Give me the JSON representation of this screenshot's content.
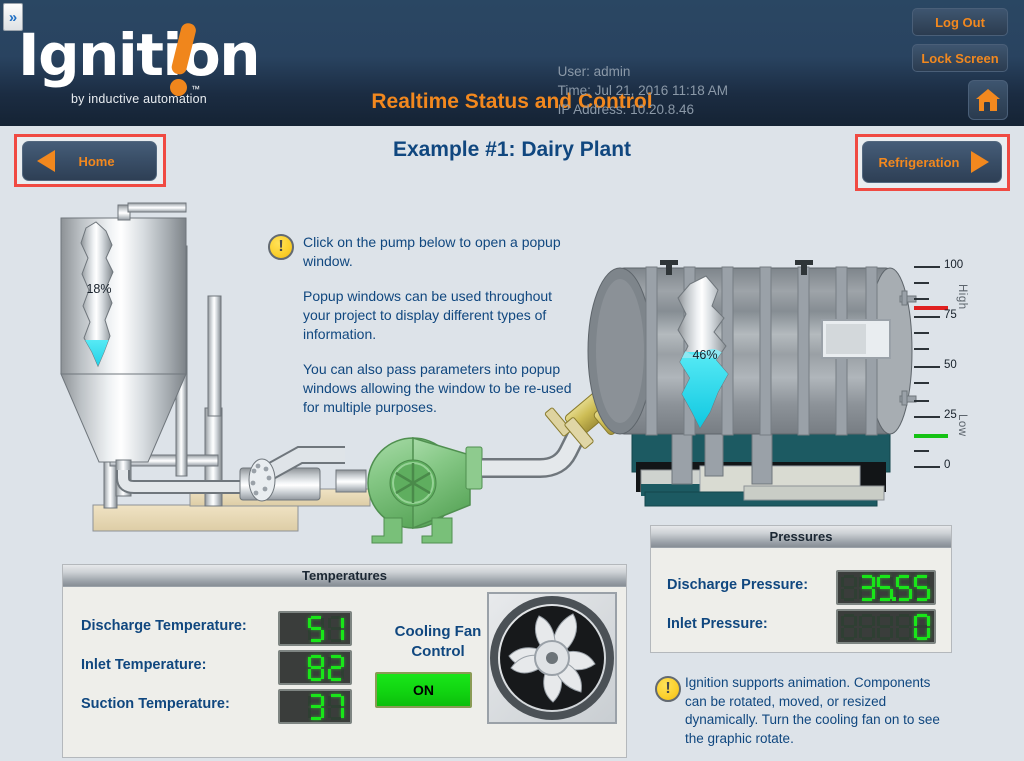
{
  "window": {
    "expander_icon": "chevron-double-right-icon"
  },
  "header": {
    "logo_word": "Ignition",
    "logo_tagline": "by inductive automation",
    "logo_tm": "™",
    "app_title": "Realtime Status and Control",
    "user_line": "User: admin",
    "time_line": "Time: Jul 21, 2016 11:18 AM",
    "ip_line": "IP Address: 10.20.8.46",
    "logout_label": "Log Out",
    "lock_label": "Lock Screen",
    "home_icon": "house-icon",
    "accent_color": "#f2881e",
    "bg_color": "#24405c"
  },
  "nav": {
    "home_label": "Home",
    "home_arrow_icon": "triangle-left-icon",
    "refrigeration_label": "Refrigeration",
    "refrigeration_arrow_icon": "triangle-right-icon",
    "highlight_color": "#f04a42"
  },
  "page": {
    "title": "Example #1: Dairy Plant",
    "title_color": "#10477f"
  },
  "instructions": {
    "icon": "exclamation-circle-icon",
    "icon_glyph": "!",
    "paragraphs": [
      "Click on the pump below to open a popup window.",
      "Popup windows can be used throughout your project to display different types of information.",
      "You can also pass parameters into popup windows allowing the window to be re-used for multiple purposes."
    ]
  },
  "process": {
    "silo_level_label": "18%",
    "silo_level_pct": 18,
    "tank_level_label": "46%",
    "tank_level_pct": 46,
    "liquid_color": "#22e0ef",
    "pump_color": "#7cc47c",
    "valve_color": "#c8b24a"
  },
  "gauge": {
    "ticks": [
      "100",
      "75",
      "50",
      "25",
      "0"
    ],
    "tick_values": [
      100,
      75,
      50,
      25,
      0
    ],
    "high_label": "High",
    "high_value": 85,
    "high_color": "#e02020",
    "low_label": "Low",
    "low_value": 15,
    "low_color": "#14c214",
    "min": 0,
    "max": 100
  },
  "temperatures": {
    "panel_title": "Temperatures",
    "rows": [
      {
        "label": "Discharge Temperature:",
        "value": "51"
      },
      {
        "label": "Inlet Temperature:",
        "value": "82"
      },
      {
        "label": "Suction Temperature:",
        "value": "37"
      }
    ],
    "fan_label_line1": "Cooling Fan",
    "fan_label_line2": "Control",
    "fan_button_state": "ON",
    "fan_icon": "fan-icon"
  },
  "pressures": {
    "panel_title": "Pressures",
    "rows": [
      {
        "label": "Discharge Pressure:",
        "value": "35.55"
      },
      {
        "label": "Inlet Pressure:",
        "value": "0"
      }
    ]
  },
  "animation_note": {
    "icon": "exclamation-circle-icon",
    "icon_glyph": "!",
    "text": "Ignition supports animation. Components can be rotated, moved, or resized dynamically. Turn the cooling fan on to see the graphic rotate."
  }
}
